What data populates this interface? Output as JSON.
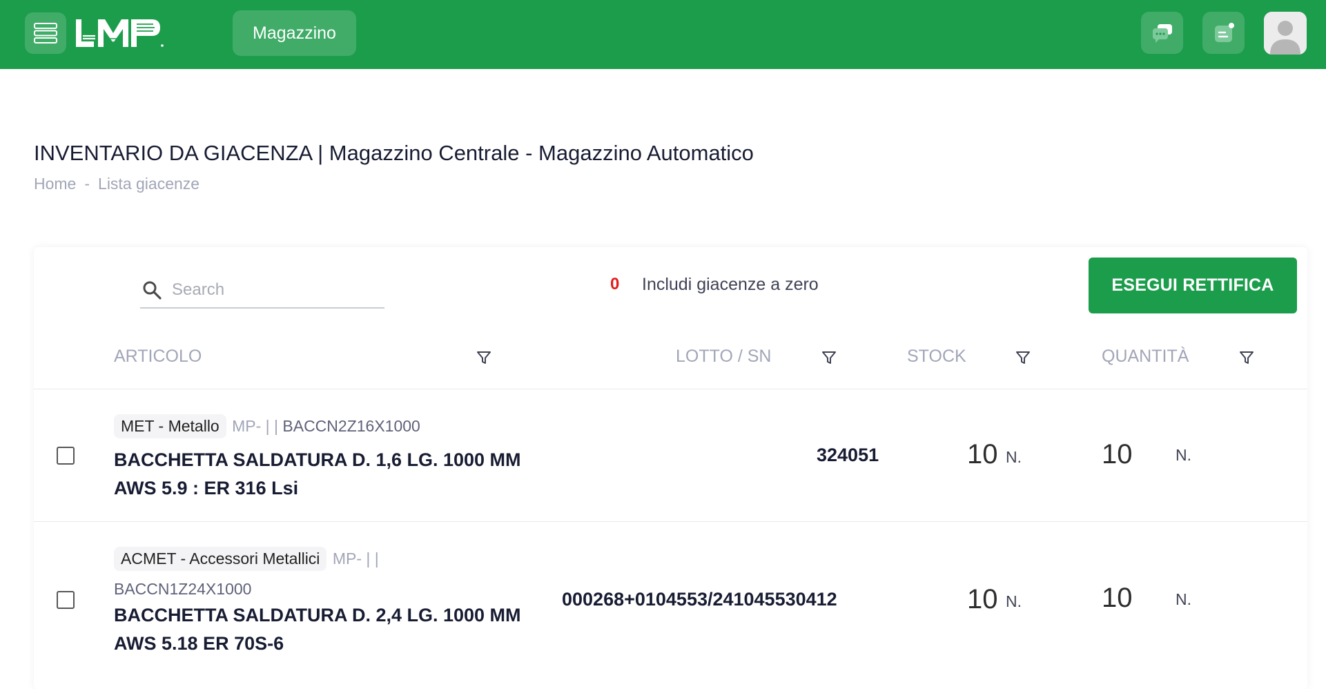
{
  "header": {
    "logo_text": "LMP",
    "nav_label": "Magazzino"
  },
  "page": {
    "title": "INVENTARIO DA GIACENZA | Magazzino Centrale - Magazzino Automatico",
    "breadcrumb": [
      "Home",
      "-",
      "Lista giacenze"
    ]
  },
  "toolbar": {
    "search_placeholder": "Search",
    "search_value": "",
    "zero_count": "0",
    "zero_label": "Includi giacenze a zero",
    "action_label": "ESEGUI RETTIFICA"
  },
  "table": {
    "columns": [
      "ARTICOLO",
      "LOTTO / SN",
      "STOCK",
      "QUANTITÀ"
    ],
    "rows": [
      {
        "category": "MET - Metallo",
        "code": "MP- | |",
        "article_code": "BACCN2Z16X1000",
        "description": "BACCHETTA SALDATURA D. 1,6 LG. 1000 MM AWS 5.9 : ER 316 Lsi",
        "lotto": "324051",
        "stock": "10",
        "stock_unit": "N.",
        "quantity": "10",
        "quantity_unit": "N."
      },
      {
        "category": "ACMET - Accessori Metallici",
        "code": "MP- | |",
        "article_code": "BACCN1Z24X1000",
        "description": "BACCHETTA SALDATURA D. 2,4 LG. 1000 MM AWS 5.18 ER 70S-6",
        "lotto": "000268+0104553/241045530412",
        "stock": "10",
        "stock_unit": "N.",
        "quantity": "10",
        "quantity_unit": "N."
      }
    ]
  },
  "colors": {
    "brand_green": "#1c9d4c",
    "zero_red": "#e21d1d"
  }
}
